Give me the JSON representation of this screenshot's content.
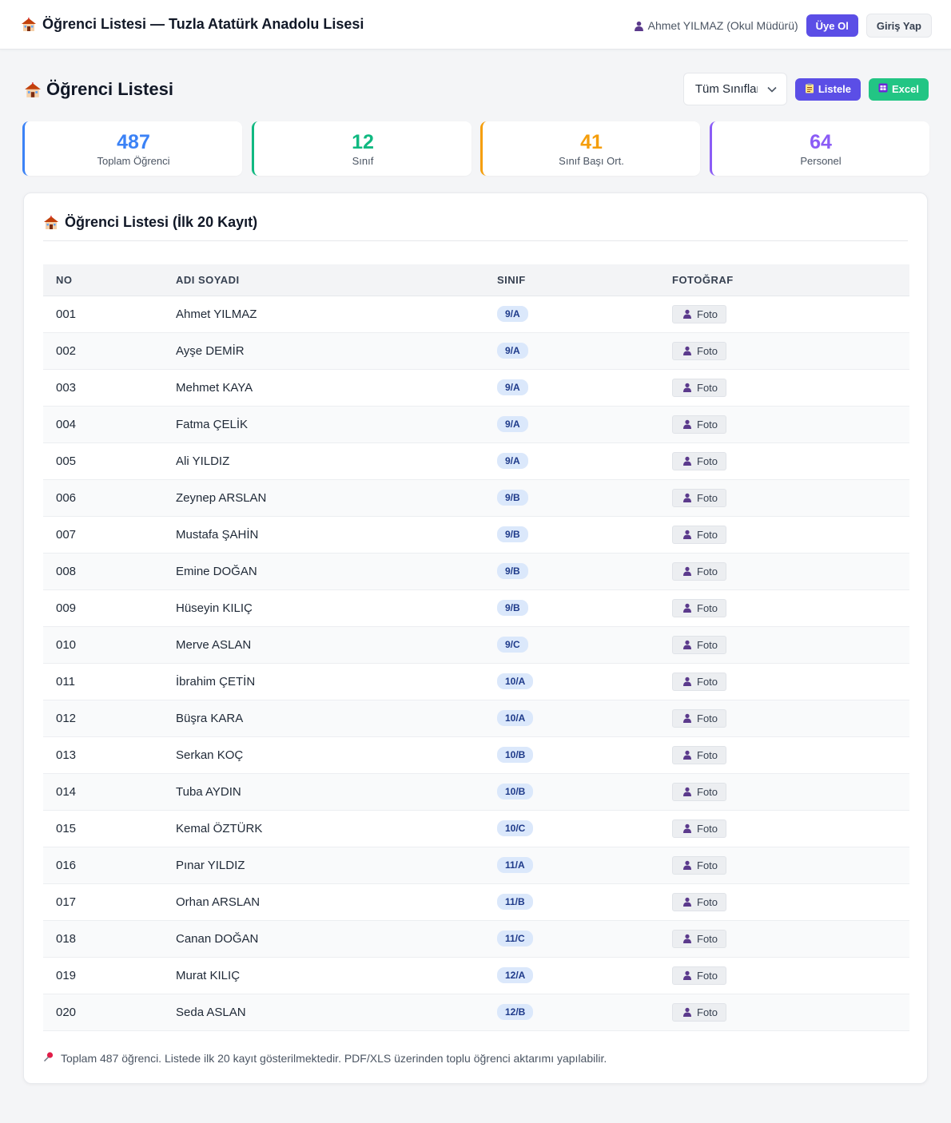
{
  "topbar": {
    "title": "Öğrenci Listesi — Tuzla Atatürk Anadolu Lisesi",
    "user_label": "Ahmet YILMAZ (Okul Müdürü)",
    "signup_label": "Üye Ol",
    "login_label": "Giriş Yap"
  },
  "page": {
    "title": "Öğrenci Listesi",
    "class_select_value": "Tüm Sınıflar",
    "list_button": "Listele",
    "excel_button": "Excel"
  },
  "stats": [
    {
      "value": "487",
      "label": "Toplam Öğrenci",
      "color": "#3b82f6"
    },
    {
      "value": "12",
      "label": "Sınıf",
      "color": "#10b981"
    },
    {
      "value": "41",
      "label": "Sınıf Başı Ort.",
      "color": "#f59e0b"
    },
    {
      "value": "64",
      "label": "Personel",
      "color": "#8b5cf6"
    }
  ],
  "table": {
    "title": "Öğrenci Listesi (İlk 20 Kayıt)",
    "headers": [
      "NO",
      "ADI SOYADI",
      "SINIF",
      "FOTOĞRAF"
    ],
    "photo_button": "Foto",
    "rows": [
      {
        "no": "001",
        "name": "Ahmet YILMAZ",
        "class": "9/A"
      },
      {
        "no": "002",
        "name": "Ayşe DEMİR",
        "class": "9/A"
      },
      {
        "no": "003",
        "name": "Mehmet KAYA",
        "class": "9/A"
      },
      {
        "no": "004",
        "name": "Fatma ÇELİK",
        "class": "9/A"
      },
      {
        "no": "005",
        "name": "Ali YILDIZ",
        "class": "9/A"
      },
      {
        "no": "006",
        "name": "Zeynep ARSLAN",
        "class": "9/B"
      },
      {
        "no": "007",
        "name": "Mustafa ŞAHİN",
        "class": "9/B"
      },
      {
        "no": "008",
        "name": "Emine DOĞAN",
        "class": "9/B"
      },
      {
        "no": "009",
        "name": "Hüseyin KILIÇ",
        "class": "9/B"
      },
      {
        "no": "010",
        "name": "Merve ASLAN",
        "class": "9/C"
      },
      {
        "no": "011",
        "name": "İbrahim ÇETİN",
        "class": "10/A"
      },
      {
        "no": "012",
        "name": "Büşra KARA",
        "class": "10/A"
      },
      {
        "no": "013",
        "name": "Serkan KOÇ",
        "class": "10/B"
      },
      {
        "no": "014",
        "name": "Tuba AYDIN",
        "class": "10/B"
      },
      {
        "no": "015",
        "name": "Kemal ÖZTÜRK",
        "class": "10/C"
      },
      {
        "no": "016",
        "name": "Pınar YILDIZ",
        "class": "11/A"
      },
      {
        "no": "017",
        "name": "Orhan ARSLAN",
        "class": "11/B"
      },
      {
        "no": "018",
        "name": "Canan DOĞAN",
        "class": "11/C"
      },
      {
        "no": "019",
        "name": "Murat KILIÇ",
        "class": "12/A"
      },
      {
        "no": "020",
        "name": "Seda ASLAN",
        "class": "12/B"
      }
    ]
  },
  "footnote": "Toplam 487 öğrenci. Listede ilk 20 kayıt gösterilmektedir. PDF/XLS üzerinden toplu öğrenci aktarımı yapılabilir.",
  "icons": {
    "school": "school-icon",
    "user": "user-icon",
    "clipboard": "clipboard-icon",
    "spreadsheet": "spreadsheet-icon",
    "pin": "pin-icon",
    "chevron": "chevron-down-icon"
  }
}
